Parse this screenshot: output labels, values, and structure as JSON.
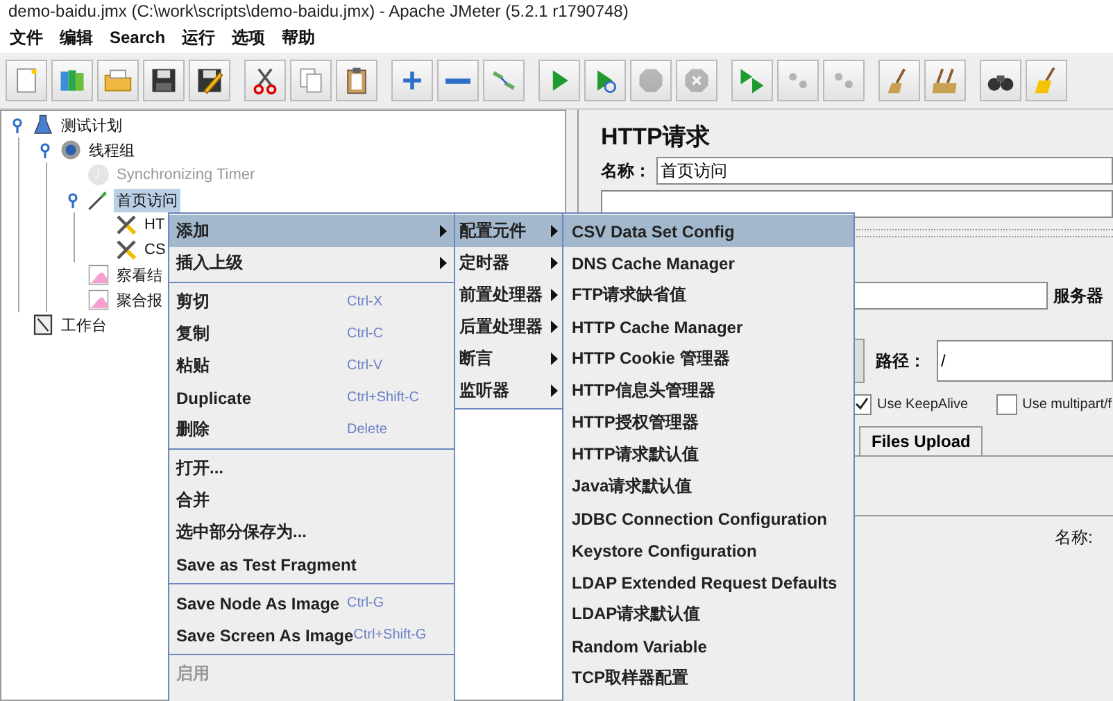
{
  "window": {
    "title": "demo-baidu.jmx (C:\\work\\scripts\\demo-baidu.jmx) - Apache JMeter (5.2.1 r1790748)"
  },
  "menu_bar": [
    "文件",
    "编辑",
    "Search",
    "运行",
    "选项",
    "帮助"
  ],
  "toolbar": [
    [
      {
        "kind": "new",
        "disabled": false
      },
      {
        "kind": "templates",
        "disabled": false
      },
      {
        "kind": "open",
        "disabled": false
      },
      {
        "kind": "save",
        "disabled": false
      },
      {
        "kind": "save_as",
        "disabled": false
      }
    ],
    [
      {
        "kind": "cut",
        "disabled": false
      },
      {
        "kind": "copy",
        "disabled": false
      },
      {
        "kind": "paste",
        "disabled": false
      }
    ],
    [
      {
        "kind": "expand",
        "disabled": false
      },
      {
        "kind": "collapse",
        "disabled": false
      },
      {
        "kind": "toggle",
        "disabled": false
      }
    ],
    [
      {
        "kind": "start",
        "disabled": false
      },
      {
        "kind": "start_no_pause",
        "disabled": false
      },
      {
        "kind": "stop",
        "disabled": true
      },
      {
        "kind": "shutdown",
        "disabled": true
      }
    ],
    [
      {
        "kind": "remote_start",
        "disabled": false
      },
      {
        "kind": "remote_stop",
        "disabled": true
      },
      {
        "kind": "remote_shutdown",
        "disabled": true
      }
    ],
    [
      {
        "kind": "clear",
        "disabled": false
      },
      {
        "kind": "clear_all",
        "disabled": false
      }
    ],
    [
      {
        "kind": "search",
        "disabled": false
      },
      {
        "kind": "reset_search",
        "disabled": false
      }
    ]
  ],
  "tree": [
    {
      "label": "测试计划",
      "kind": "plan",
      "selected": false,
      "disabled": false,
      "expanded": true,
      "children": [
        {
          "label": "线程组",
          "kind": "thread",
          "selected": false,
          "disabled": false,
          "expanded": true,
          "children": [
            {
              "label": "Synchronizing Timer",
              "kind": "timer",
              "selected": false,
              "disabled": true
            },
            {
              "label": "首页访问",
              "kind": "sampler",
              "selected": true,
              "disabled": false,
              "expanded": true,
              "children": [
                {
                  "label": "HT",
                  "kind": "config",
                  "selected": false,
                  "disabled": false
                },
                {
                  "label": "CS",
                  "kind": "config",
                  "selected": false,
                  "disabled": false
                }
              ]
            },
            {
              "label": "察看结",
              "kind": "listener",
              "selected": false,
              "disabled": false
            },
            {
              "label": "聚合报",
              "kind": "listener",
              "selected": false,
              "disabled": false
            }
          ]
        }
      ]
    },
    {
      "label": "工作台",
      "kind": "workbench",
      "selected": false,
      "disabled": false
    }
  ],
  "editor": {
    "title": "HTTP请求",
    "name_label": "名称：",
    "name_value": "首页访问",
    "server_label": "服务器",
    "path_label": "路径：",
    "path_value": "/",
    "checkboxes": [
      {
        "label": "Use KeepAlive",
        "checked": true
      },
      {
        "label": "Use multipart/f",
        "checked": false
      }
    ],
    "tabs": [
      {
        "label": "Files Upload",
        "selected": false
      }
    ],
    "table_label": "名称:"
  },
  "context_menu": [
    {
      "kind": "submenu",
      "label": "添加",
      "selected": true,
      "disabled": false
    },
    {
      "kind": "submenu",
      "label": "插入上级",
      "selected": false,
      "disabled": false
    },
    {
      "kind": "separator"
    },
    {
      "kind": "item",
      "label": "剪切",
      "shortcut": "Ctrl-X",
      "selected": false,
      "disabled": false
    },
    {
      "kind": "item",
      "label": "复制",
      "shortcut": "Ctrl-C",
      "selected": false,
      "disabled": false
    },
    {
      "kind": "item",
      "label": "粘贴",
      "shortcut": "Ctrl-V",
      "selected": false,
      "disabled": false
    },
    {
      "kind": "item",
      "label": "Duplicate",
      "shortcut": "Ctrl+Shift-C",
      "selected": false,
      "disabled": false
    },
    {
      "kind": "item",
      "label": "删除",
      "shortcut": "Delete",
      "selected": false,
      "disabled": false
    },
    {
      "kind": "separator"
    },
    {
      "kind": "item",
      "label": "打开...",
      "selected": false,
      "disabled": false
    },
    {
      "kind": "item",
      "label": "合并",
      "selected": false,
      "disabled": false
    },
    {
      "kind": "item",
      "label": "选中部分保存为...",
      "selected": false,
      "disabled": false
    },
    {
      "kind": "item",
      "label": "Save as Test Fragment",
      "selected": false,
      "disabled": false
    },
    {
      "kind": "separator"
    },
    {
      "kind": "item",
      "label": "Save Node As Image",
      "shortcut": "Ctrl-G",
      "selected": false,
      "disabled": false
    },
    {
      "kind": "item",
      "label": "Save Screen As Image",
      "shortcut": "Ctrl+Shift-G",
      "selected": false,
      "disabled": false
    },
    {
      "kind": "separator"
    },
    {
      "kind": "item",
      "label": "启用",
      "selected": false,
      "disabled": true
    }
  ],
  "add_submenu": [
    {
      "kind": "submenu",
      "label": "配置元件",
      "selected": true
    },
    {
      "kind": "submenu",
      "label": "定时器",
      "selected": false
    },
    {
      "kind": "submenu",
      "label": "前置处理器",
      "selected": false
    },
    {
      "kind": "submenu",
      "label": "后置处理器",
      "selected": false
    },
    {
      "kind": "submenu",
      "label": "断言",
      "selected": false
    },
    {
      "kind": "submenu",
      "label": "监听器",
      "selected": false
    }
  ],
  "config_submenu": [
    {
      "label": "CSV Data Set Config",
      "selected": true
    },
    {
      "label": "DNS Cache Manager",
      "selected": false
    },
    {
      "label": "FTP请求缺省值",
      "selected": false
    },
    {
      "label": "HTTP Cache Manager",
      "selected": false
    },
    {
      "label": "HTTP Cookie 管理器",
      "selected": false
    },
    {
      "label": "HTTP信息头管理器",
      "selected": false
    },
    {
      "label": "HTTP授权管理器",
      "selected": false
    },
    {
      "label": "HTTP请求默认值",
      "selected": false
    },
    {
      "label": "Java请求默认值",
      "selected": false
    },
    {
      "label": "JDBC Connection Configuration",
      "selected": false
    },
    {
      "label": "Keystore Configuration",
      "selected": false
    },
    {
      "label": "LDAP Extended Request Defaults",
      "selected": false
    },
    {
      "label": "LDAP请求默认值",
      "selected": false
    },
    {
      "label": "Random Variable",
      "selected": false
    },
    {
      "label": "TCP取样器配置",
      "selected": false
    }
  ]
}
